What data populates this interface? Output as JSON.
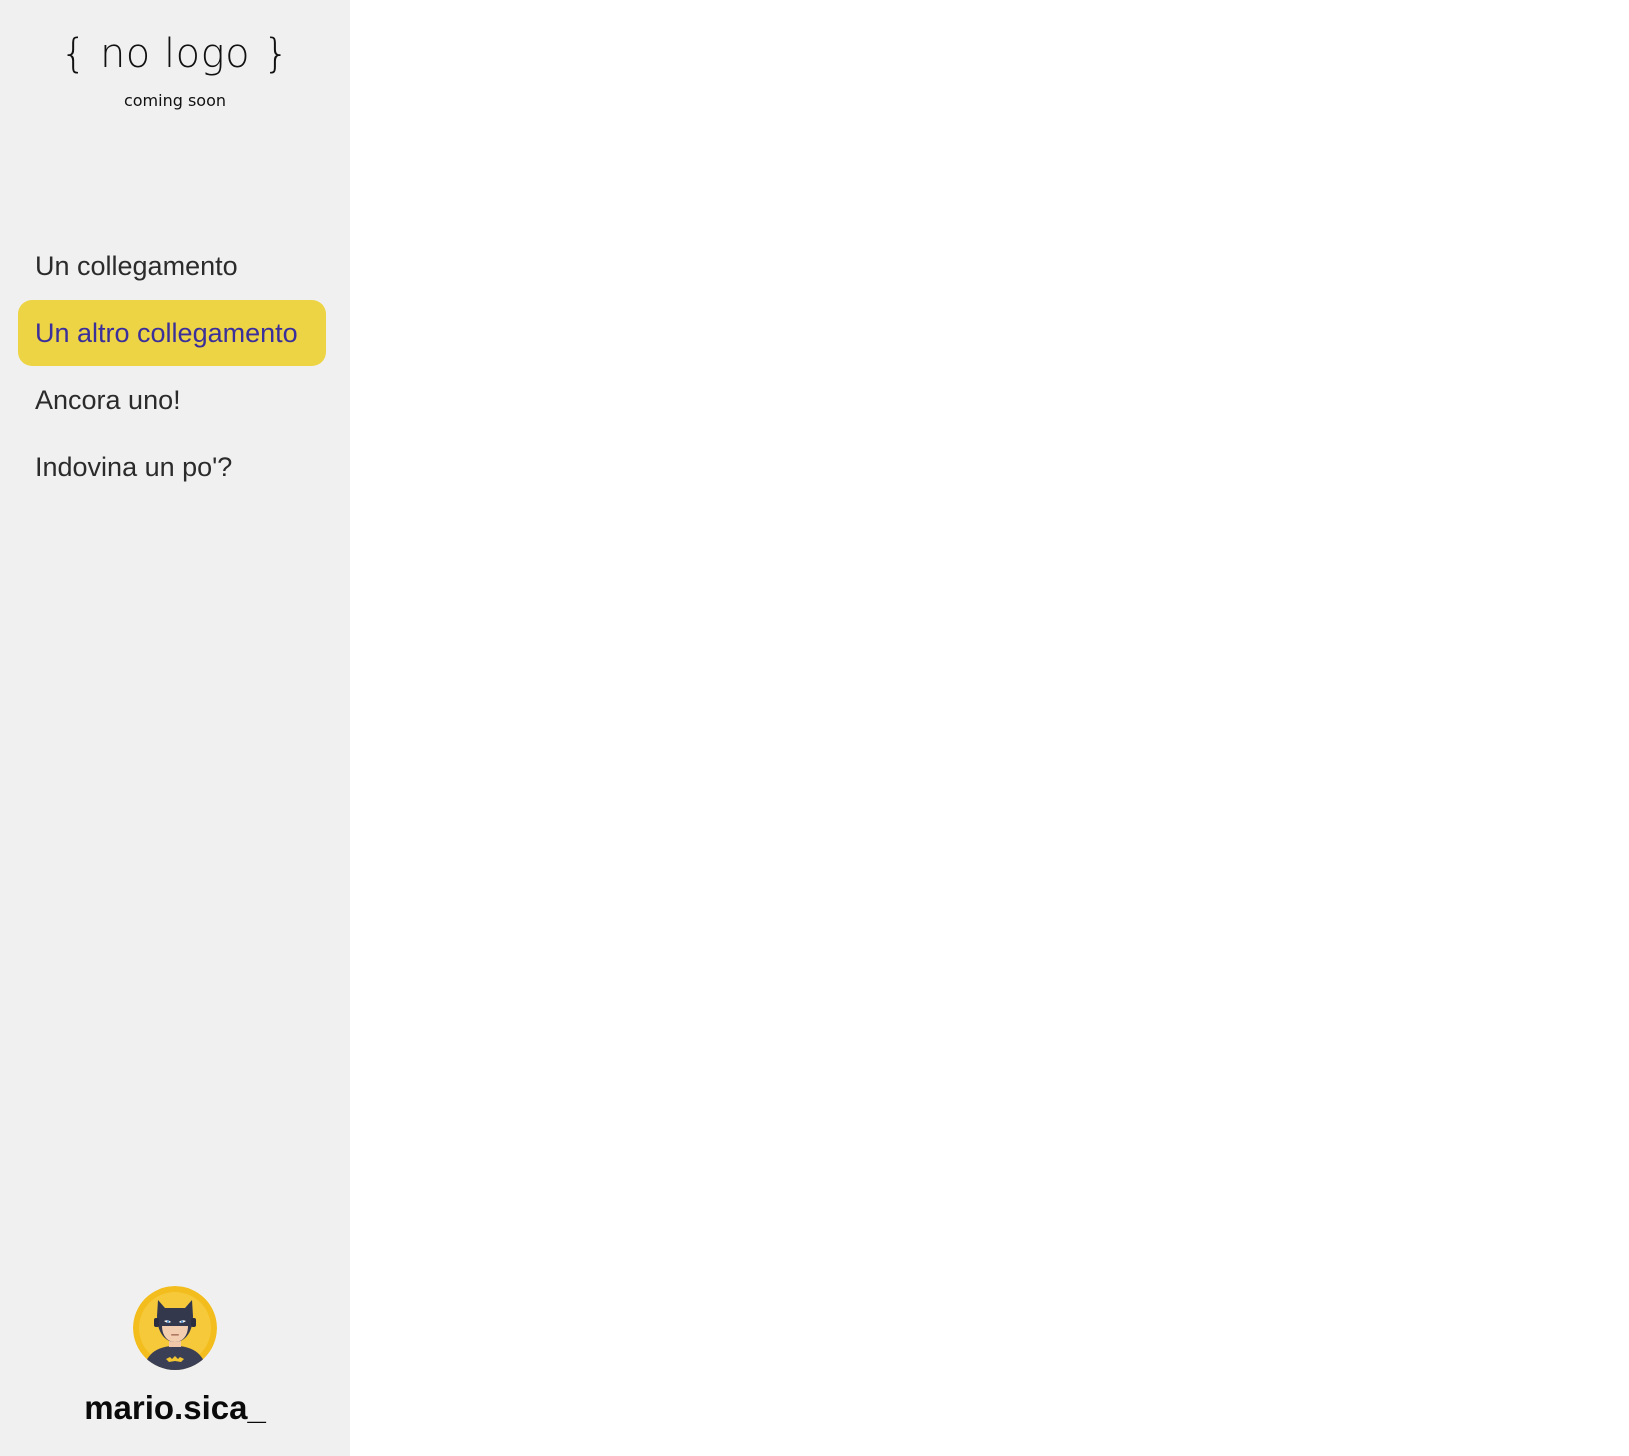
{
  "logo": {
    "title": "{ no logo }",
    "subtitle": "coming soon"
  },
  "nav": {
    "items": [
      {
        "label": "Un collegamento",
        "active": false
      },
      {
        "label": "Un altro collegamento",
        "active": true
      },
      {
        "label": "Ancora uno!",
        "active": false
      },
      {
        "label": "Indovina un po'?",
        "active": false
      }
    ]
  },
  "user": {
    "name": "mario.sica_",
    "avatar_icon": "batman-avatar-icon"
  },
  "colors": {
    "sidebar_bg": "#f0f0f0",
    "active_bg": "#edd444",
    "active_text": "#3a2f9b",
    "avatar_ring": "#f2bd1d"
  }
}
